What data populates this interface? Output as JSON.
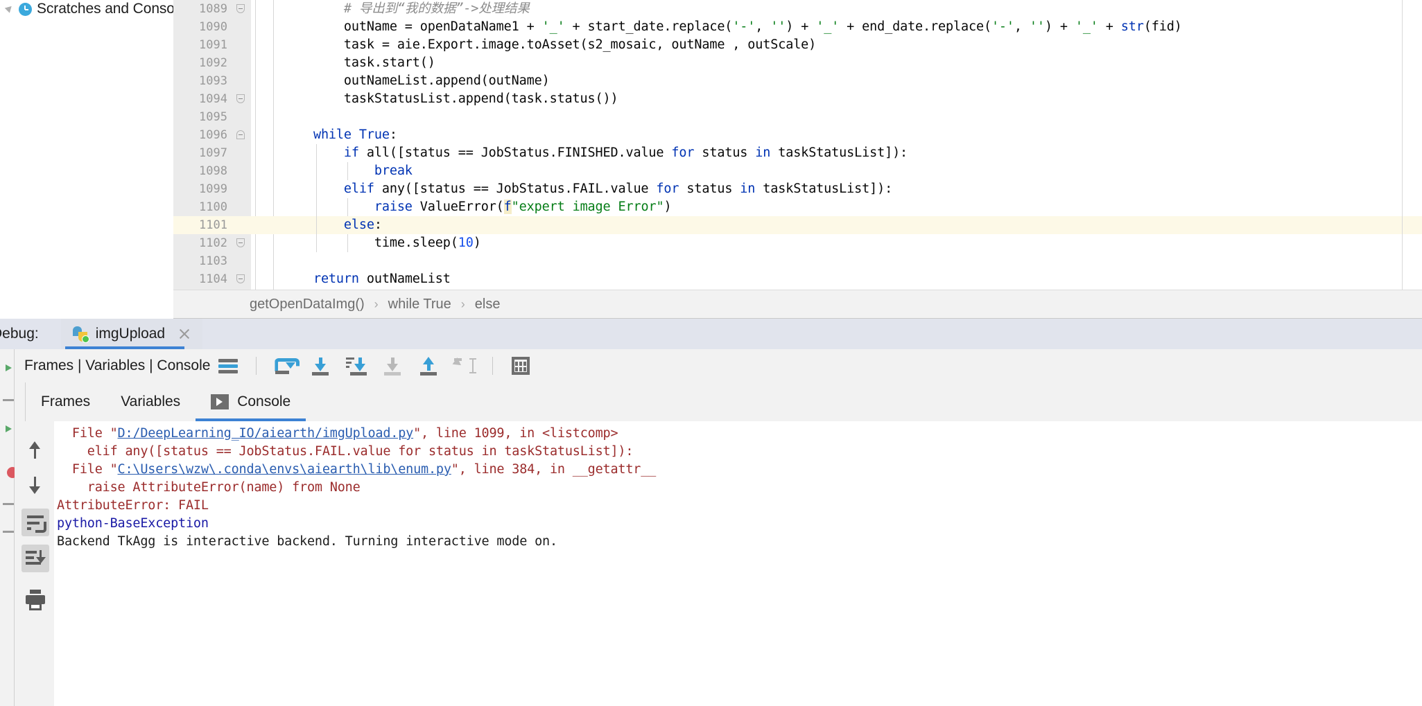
{
  "project_panel": {
    "node_label": "Scratches and Consoles",
    "expand_arrow_icon": "collapse-arrow-icon",
    "node_icon": "clock-icon"
  },
  "editor": {
    "right_margin_guide": true,
    "lines": [
      {
        "number": "1089",
        "fold": "end",
        "indent_guides": 0,
        "highlight": false,
        "segments": [
          {
            "text": "        # ",
            "cls": "comment"
          },
          {
            "text": "导出到“我的数据”->处理结果",
            "cls": "comment"
          }
        ]
      },
      {
        "number": "1090",
        "fold": "",
        "indent_guides": 0,
        "highlight": false,
        "segments": [
          {
            "text": "        outName = openDataName1 + ",
            "cls": ""
          },
          {
            "text": "'_'",
            "cls": "str"
          },
          {
            "text": " + start_date.replace(",
            "cls": ""
          },
          {
            "text": "'-'",
            "cls": "str"
          },
          {
            "text": ", ",
            "cls": ""
          },
          {
            "text": "''",
            "cls": "str"
          },
          {
            "text": ") + ",
            "cls": ""
          },
          {
            "text": "'_'",
            "cls": "str"
          },
          {
            "text": " + end_date.replace(",
            "cls": ""
          },
          {
            "text": "'-'",
            "cls": "str"
          },
          {
            "text": ", ",
            "cls": ""
          },
          {
            "text": "''",
            "cls": "str"
          },
          {
            "text": ") + ",
            "cls": ""
          },
          {
            "text": "'_'",
            "cls": "str"
          },
          {
            "text": " + ",
            "cls": ""
          },
          {
            "text": "str",
            "cls": "kw"
          },
          {
            "text": "(fid)",
            "cls": ""
          }
        ]
      },
      {
        "number": "1091",
        "fold": "",
        "indent_guides": 0,
        "highlight": false,
        "segments": [
          {
            "text": "        task = aie.Export.image.toAsset(s2_mosaic, outName , outScale)",
            "cls": ""
          }
        ]
      },
      {
        "number": "1092",
        "fold": "",
        "indent_guides": 0,
        "highlight": false,
        "segments": [
          {
            "text": "        task.start()",
            "cls": ""
          }
        ]
      },
      {
        "number": "1093",
        "fold": "",
        "indent_guides": 0,
        "highlight": false,
        "segments": [
          {
            "text": "        outNameList.append(outName)",
            "cls": ""
          }
        ]
      },
      {
        "number": "1094",
        "fold": "end",
        "indent_guides": 0,
        "highlight": false,
        "segments": [
          {
            "text": "        taskStatusList.append(task.status())",
            "cls": ""
          }
        ]
      },
      {
        "number": "1095",
        "fold": "",
        "indent_guides": 0,
        "highlight": false,
        "segments": []
      },
      {
        "number": "1096",
        "fold": "start",
        "indent_guides": 0,
        "highlight": false,
        "segments": [
          {
            "text": "    ",
            "cls": ""
          },
          {
            "text": "while",
            "cls": "kw"
          },
          {
            "text": " ",
            "cls": ""
          },
          {
            "text": "True",
            "cls": "kw"
          },
          {
            "text": ":",
            "cls": ""
          }
        ]
      },
      {
        "number": "1097",
        "fold": "",
        "indent_guides": 1,
        "highlight": false,
        "segments": [
          {
            "text": "        ",
            "cls": ""
          },
          {
            "text": "if",
            "cls": "kw"
          },
          {
            "text": " all([status == JobStatus.FINISHED.value ",
            "cls": ""
          },
          {
            "text": "for",
            "cls": "kw"
          },
          {
            "text": " status ",
            "cls": ""
          },
          {
            "text": "in",
            "cls": "kw"
          },
          {
            "text": " taskStatusList]):",
            "cls": ""
          }
        ]
      },
      {
        "number": "1098",
        "fold": "",
        "indent_guides": 2,
        "highlight": false,
        "segments": [
          {
            "text": "            ",
            "cls": ""
          },
          {
            "text": "break",
            "cls": "kw"
          }
        ]
      },
      {
        "number": "1099",
        "fold": "",
        "indent_guides": 1,
        "highlight": false,
        "segments": [
          {
            "text": "        ",
            "cls": ""
          },
          {
            "text": "elif",
            "cls": "kw"
          },
          {
            "text": " any([status == JobStatus.FAIL.value ",
            "cls": ""
          },
          {
            "text": "for",
            "cls": "kw"
          },
          {
            "text": " status ",
            "cls": ""
          },
          {
            "text": "in",
            "cls": "kw"
          },
          {
            "text": " taskStatusList]):",
            "cls": ""
          }
        ]
      },
      {
        "number": "1100",
        "fold": "",
        "indent_guides": 2,
        "highlight": false,
        "segments": [
          {
            "text": "            ",
            "cls": ""
          },
          {
            "text": "raise",
            "cls": "kw"
          },
          {
            "text": " ValueError(",
            "cls": ""
          },
          {
            "text": "f",
            "cls": "fprefix"
          },
          {
            "text": "\"expert image Error\"",
            "cls": "str"
          },
          {
            "text": ")",
            "cls": ""
          }
        ]
      },
      {
        "number": "1101",
        "fold": "",
        "indent_guides": 1,
        "highlight": true,
        "segments": [
          {
            "text": "        ",
            "cls": ""
          },
          {
            "text": "else",
            "cls": "kw"
          },
          {
            "text": ":",
            "cls": ""
          }
        ]
      },
      {
        "number": "1102",
        "fold": "end",
        "indent_guides": 2,
        "highlight": false,
        "segments": [
          {
            "text": "            time.sleep(",
            "cls": ""
          },
          {
            "text": "10",
            "cls": "num"
          },
          {
            "text": ")",
            "cls": ""
          }
        ]
      },
      {
        "number": "1103",
        "fold": "",
        "indent_guides": 0,
        "highlight": false,
        "segments": []
      },
      {
        "number": "1104",
        "fold": "end",
        "indent_guides": 0,
        "highlight": false,
        "segments": [
          {
            "text": "    ",
            "cls": ""
          },
          {
            "text": "return",
            "cls": "kw"
          },
          {
            "text": " outNameList",
            "cls": ""
          }
        ]
      }
    ]
  },
  "breadcrumb": {
    "items": [
      "getOpenDataImg()",
      "while True",
      "else"
    ],
    "separator": "›"
  },
  "debug": {
    "window_title": "Debug:",
    "tab": {
      "label": "imgUpload",
      "icon": "python-file-icon",
      "close_icon": "close-icon"
    },
    "toolbar": {
      "label": "Frames | Variables | Console",
      "buttons": [
        {
          "name": "layout-settings-button",
          "icon": "bars-icon",
          "enabled": true
        },
        {
          "name": "step-over-button",
          "icon": "step-over-icon",
          "enabled": true
        },
        {
          "name": "step-into-button",
          "icon": "step-into-icon",
          "enabled": true
        },
        {
          "name": "force-step-into-button",
          "icon": "force-step-into-icon",
          "enabled": true
        },
        {
          "name": "step-out-button",
          "icon": "step-out-icon",
          "enabled": true
        },
        {
          "name": "run-to-cursor-button",
          "icon": "run-to-cursor-icon",
          "enabled": false
        },
        {
          "name": "evaluate-expression-button",
          "icon": "calculator-icon",
          "enabled": true
        }
      ]
    },
    "tabs": [
      {
        "label": "Frames",
        "active": false,
        "icon": ""
      },
      {
        "label": "Variables",
        "active": false,
        "icon": ""
      },
      {
        "label": "Console",
        "active": true,
        "icon": "console-icon"
      }
    ],
    "console_rail": [
      {
        "name": "up-button",
        "icon": "arrow-up-icon",
        "active": false
      },
      {
        "name": "down-button",
        "icon": "arrow-down-icon",
        "active": false
      },
      {
        "name": "soft-wrap-button",
        "icon": "soft-wrap-icon",
        "active": true
      },
      {
        "name": "scroll-to-end-button",
        "icon": "scroll-to-end-icon",
        "active": true
      },
      {
        "name": "print-button",
        "icon": "print-icon",
        "active": false
      }
    ],
    "console_output": [
      {
        "segments": [
          {
            "text": "  File \"",
            "cls": "con-err"
          },
          {
            "text": "D:/DeepLearning_IO/aiearth/imgUpload.py",
            "cls": "con-link"
          },
          {
            "text": "\", line 1099, in <listcomp>",
            "cls": "con-err"
          }
        ]
      },
      {
        "segments": [
          {
            "text": "    elif any([status == JobStatus.FAIL.value for status in taskStatusList]):",
            "cls": "con-err"
          }
        ]
      },
      {
        "segments": [
          {
            "text": "  File \"",
            "cls": "con-err"
          },
          {
            "text": "C:\\Users\\wzw\\.conda\\envs\\aiearth\\lib\\enum.py",
            "cls": "con-link"
          },
          {
            "text": "\", line 384, in __getattr__",
            "cls": "con-err"
          }
        ]
      },
      {
        "segments": [
          {
            "text": "    raise AttributeError(name) from None",
            "cls": "con-err"
          }
        ]
      },
      {
        "segments": [
          {
            "text": "AttributeError: FAIL",
            "cls": "con-err"
          }
        ]
      },
      {
        "segments": [
          {
            "text": "python-BaseException",
            "cls": "con-blue"
          }
        ]
      },
      {
        "segments": [
          {
            "text": "Backend TkAgg is interactive backend. Turning interactive mode on.",
            "cls": "con-plain"
          }
        ]
      }
    ]
  },
  "colors": {
    "accent": "#3d82d4",
    "keyword": "#0033b3",
    "string": "#067d17",
    "number": "#1750eb",
    "comment": "#8c8c8c",
    "error": "#9b2c2c",
    "link": "#2a5db0",
    "highlight_line": "#fdf9e7"
  }
}
